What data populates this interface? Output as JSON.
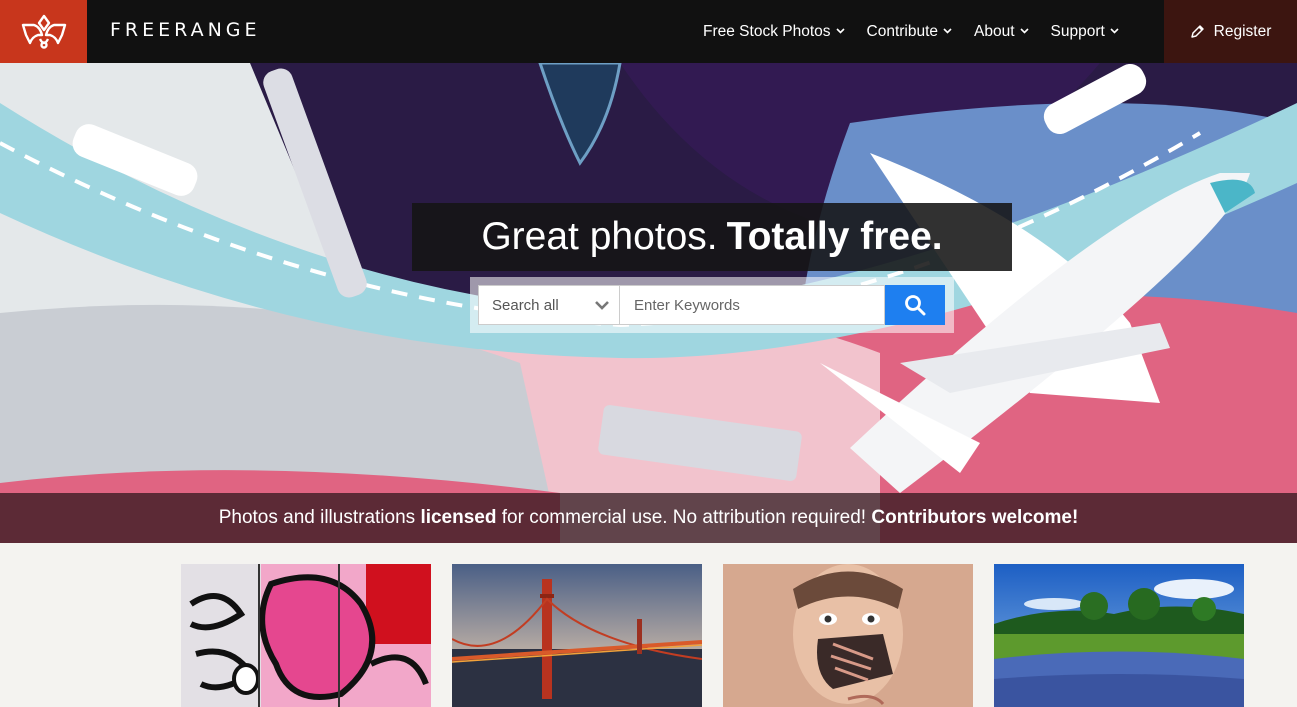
{
  "header": {
    "brand": "FREERANGE",
    "nav": [
      {
        "label": "Free Stock Photos"
      },
      {
        "label": "Contribute"
      },
      {
        "label": "About"
      },
      {
        "label": "Support"
      }
    ],
    "register_label": "Register"
  },
  "hero": {
    "headline_light": "Great photos.",
    "headline_bold": "Totally free.",
    "search": {
      "category_selected": "Search all",
      "placeholder": "Enter Keywords"
    },
    "tagline": {
      "part1": "Photos and illustrations",
      "part2": "licensed",
      "part3": "for commercial use. No attribution required!",
      "part4": "Contributors welcome!"
    }
  },
  "colors": {
    "brand_red": "#c8361c",
    "register_bg": "#3c1510",
    "search_blue": "#1e7ff0",
    "header_bg": "#111111"
  },
  "icons": [
    "logo-icon",
    "chevron-down-icon",
    "pencil-icon",
    "search-icon"
  ],
  "thumbnails": [
    {
      "subject": "graffiti"
    },
    {
      "subject": "golden-gate-bridge"
    },
    {
      "subject": "painted-face"
    },
    {
      "subject": "bluebonnet-field"
    }
  ]
}
